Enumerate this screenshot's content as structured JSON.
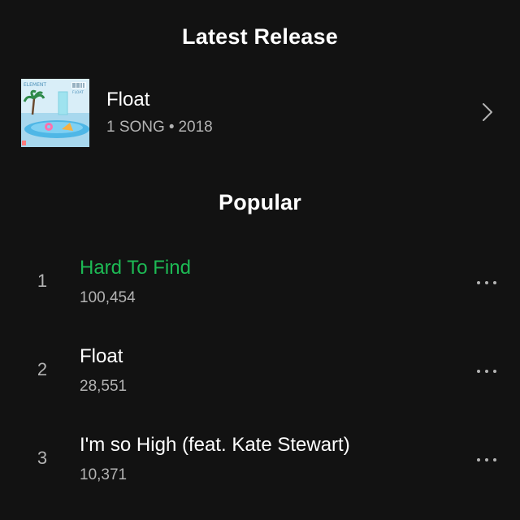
{
  "latest_release": {
    "heading": "Latest Release",
    "album": {
      "name": "Float",
      "song_count": "1 SONG",
      "separator": "•",
      "year": "2018",
      "cover_text": {
        "artist": "ELEMENT",
        "title": "FLOAT"
      }
    },
    "chevron_icon": "chevron-right-icon"
  },
  "popular": {
    "heading": "Popular",
    "tracks": [
      {
        "number": "1",
        "title": "Hard To Find",
        "plays": "100,454",
        "playing": true
      },
      {
        "number": "2",
        "title": "Float",
        "plays": "28,551",
        "playing": false
      },
      {
        "number": "3",
        "title": "I'm so High (feat. Kate Stewart)",
        "plays": "10,371",
        "playing": false
      }
    ],
    "more_icon": "more-options-icon"
  },
  "colors": {
    "background": "#121212",
    "accent": "#1db954",
    "secondary_text": "#b3b3b3",
    "primary_text": "#ffffff"
  }
}
